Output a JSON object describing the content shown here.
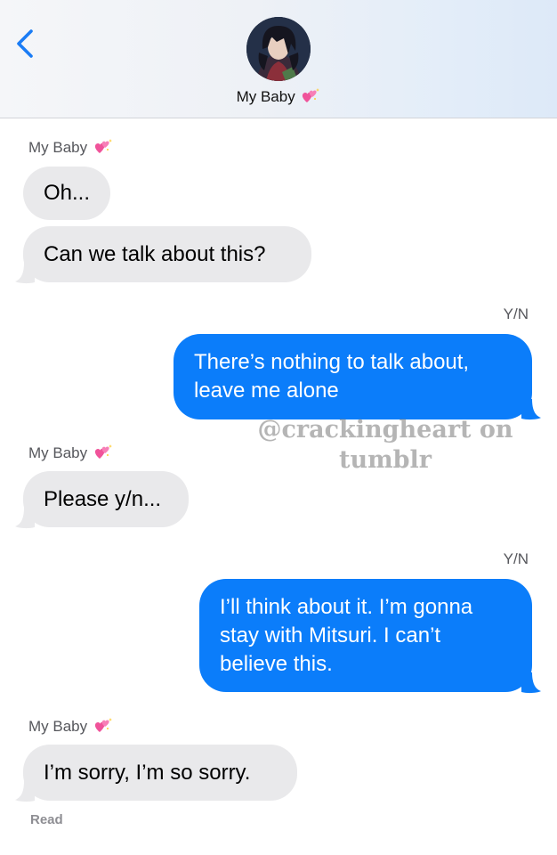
{
  "header": {
    "contact_name": "My Baby",
    "heart_icon": "sparkling-heart-emoji"
  },
  "conversation": {
    "sender_name": "My Baby",
    "me_name": "Y/N",
    "messages": [
      {
        "from": "them",
        "text": "Oh..."
      },
      {
        "from": "them",
        "text": "Can we talk about this?"
      },
      {
        "from": "me",
        "lines": [
          "There’s nothing to talk about,",
          "leave me alone"
        ]
      },
      {
        "from": "them",
        "text": "Please y/n..."
      },
      {
        "from": "me",
        "lines": [
          "I’ll think about it. I’m gonna",
          "stay with Mitsuri. I can’t",
          "believe this."
        ]
      },
      {
        "from": "them",
        "text": "I’m sorry, I’m so sorry."
      }
    ],
    "read_receipt": "Read"
  },
  "watermark": {
    "line1": "@crackingheart on",
    "line2": "tumblr"
  },
  "colors": {
    "outgoing_bubble": "#0b7dfa",
    "incoming_bubble": "#e9e9eb",
    "accent": "#1a7cf5"
  }
}
